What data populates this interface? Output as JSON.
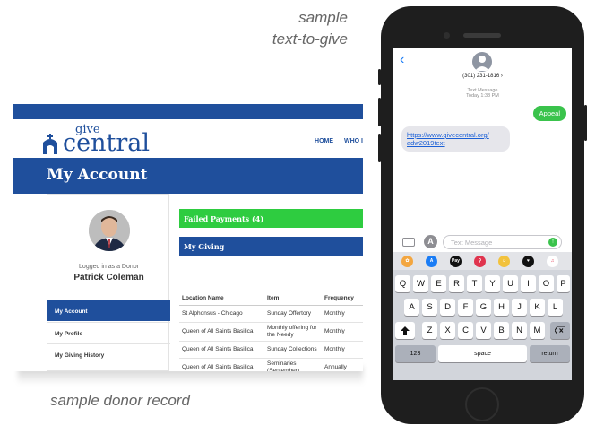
{
  "captions": {
    "top_line1": "sample",
    "top_line2": "text-to-give",
    "bottom": "sample donor record"
  },
  "donor_record": {
    "logo_give": "give",
    "logo_central": "central",
    "nav": [
      "HOME",
      "WHO I"
    ],
    "page_title": "My Account",
    "sidebar": {
      "logged_in_as": "Logged in as a Donor",
      "donor_name": "Patrick Coleman",
      "items": [
        "My Account",
        "My Profile",
        "My Giving History"
      ]
    },
    "failed_payments": "Failed Payments (4)",
    "my_giving": "My Giving",
    "table": {
      "headers": [
        "Location Name",
        "Item",
        "Frequency"
      ],
      "rows": [
        [
          "St Alphonsus - Chicago",
          "Sunday Offertory",
          "Monthly"
        ],
        [
          "Queen of All Saints Basilica",
          "Monthly offering for the Needy",
          "Monthly"
        ],
        [
          "Queen of All Saints Basilica",
          "Sunday Collections",
          "Monthly"
        ],
        [
          "Queen of All Saints Basilica",
          "Seminaries (September)",
          "Annually"
        ]
      ]
    }
  },
  "phone": {
    "contact_number": "(301) 231-1816 ›",
    "meta_line1": "Text Message",
    "meta_line2": "Today 1:38 PM",
    "outgoing_message": "Appeal",
    "incoming_link_line1": "https://www.givecentral.org/",
    "incoming_link_line2": "adw2019text",
    "input_placeholder": "Text Message",
    "keyboard": {
      "row1": [
        "Q",
        "W",
        "E",
        "R",
        "T",
        "Y",
        "U",
        "I",
        "O",
        "P"
      ],
      "row2": [
        "A",
        "S",
        "D",
        "F",
        "G",
        "H",
        "J",
        "K",
        "L"
      ],
      "row3": [
        "Z",
        "X",
        "C",
        "V",
        "B",
        "N",
        "M"
      ],
      "numbers_key": "123",
      "space_key": "space",
      "return_key": "return",
      "applepay_label": "Pay"
    }
  },
  "colors": {
    "brand_blue": "#1f4f9c",
    "success_green": "#2ecc40",
    "imessage_green": "#3ac34c",
    "ios_blue": "#1a7cf5"
  }
}
